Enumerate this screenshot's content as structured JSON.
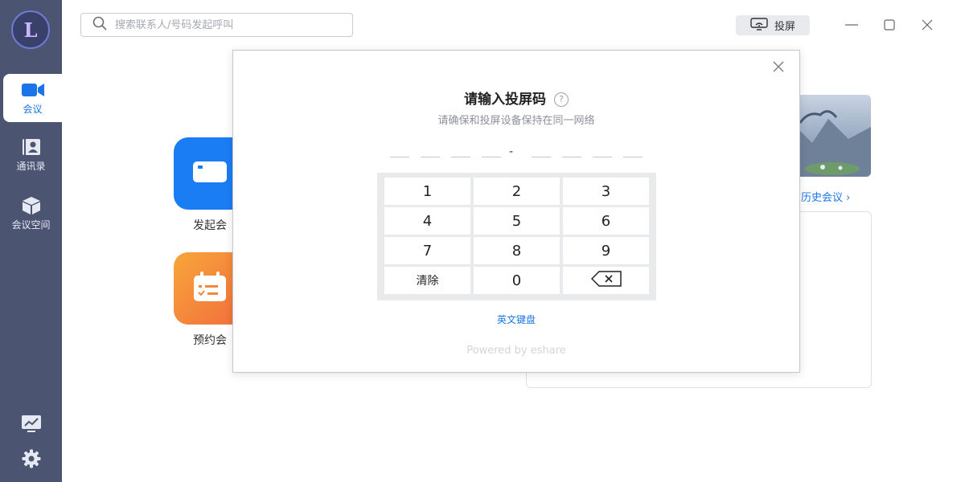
{
  "app": {
    "logo_letter": "L"
  },
  "sidebar": {
    "items": [
      {
        "label": "会议",
        "icon": "video-camera-icon",
        "active": true
      },
      {
        "label": "通讯录",
        "icon": "contacts-icon",
        "active": false
      },
      {
        "label": "会议空间",
        "icon": "cube-icon",
        "active": false
      }
    ],
    "bottom_icons": [
      "monitor-chart-icon",
      "gear-icon"
    ]
  },
  "search": {
    "placeholder": "搜索联系人/号码发起呼叫"
  },
  "toolbar": {
    "cast_label": "投屏"
  },
  "main": {
    "start_meeting_label": "发起会",
    "schedule_meeting_label": "预约会",
    "history_link": "历史会议 ›"
  },
  "modal": {
    "title": "请输入投屏码",
    "subtitle": "请确保和投屏设备保持在同一网络",
    "code_separator": "-",
    "keys": [
      "1",
      "2",
      "3",
      "4",
      "5",
      "6",
      "7",
      "8",
      "9",
      "清除",
      "0"
    ],
    "english_keyboard_link": "英文键盘",
    "powered_by": "Powered by eshare"
  },
  "colors": {
    "sidebar_bg": "#4b5571",
    "accent": "#1c75e8",
    "tile_blue": "#1a7df4",
    "tile_orange": "#f26d3d"
  }
}
